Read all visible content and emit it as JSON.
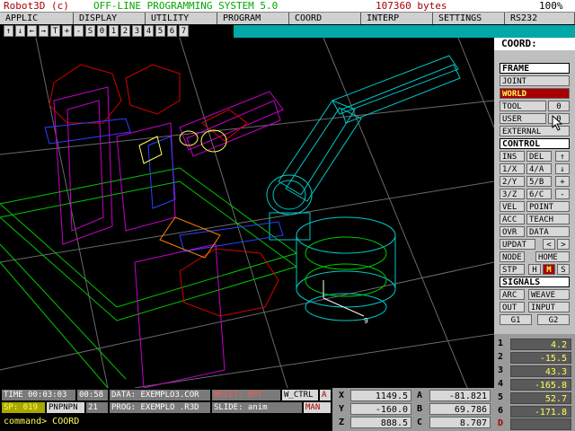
{
  "titlebar": {
    "app": "Robot3D (c)",
    "title": "OFF-LINE PROGRAMMING SYSTEM 5.0",
    "memory": "107360 bytes",
    "zoom": "100%"
  },
  "menu": [
    "APPLIC",
    "DISPLAY",
    "UTILITY",
    "PROGRAM",
    "COORD",
    "",
    "INTERP",
    "SETTINGS",
    "RS232"
  ],
  "toolbar": [
    "↑",
    "↓",
    "←",
    "→",
    "T",
    "+",
    "-",
    "S",
    "0",
    "1",
    "2",
    "3",
    "4",
    "5",
    "6",
    "7"
  ],
  "panel": {
    "coord_header": "COORD:",
    "frame_title": "FRAME",
    "joint": "JOINT",
    "world": "WORLD",
    "tool": "TOOL",
    "tool_val": "0",
    "user": "USER",
    "user_val": "0",
    "external": "EXTERNAL",
    "control_title": "CONTROL",
    "ins": "INS",
    "del": "DEL",
    "up": "↑",
    "k1x": "1/X",
    "k4a": "4/A",
    "down": "↓",
    "k2y": "2/Y",
    "k5b": "5/B",
    "plus": "+",
    "k3z": "3/Z",
    "k6c": "6/C",
    "minus": "-",
    "vel": "VEL",
    "point": "POINT",
    "acc": "ACC",
    "teach": "TEACH",
    "ovr": "OVR",
    "data": "DATA",
    "updat": "UPDAT",
    "lt": "<",
    "gt": ">",
    "node": "NODE",
    "home": "HOME",
    "stp": "STP",
    "h": "H",
    "m": "M",
    "s": "S",
    "signals_title": "SIGNALS",
    "arc": "ARC",
    "weave": "WEAVE",
    "out": "OUT",
    "input": "INPUT",
    "g1": "G1",
    "g2": "G2"
  },
  "status": {
    "time": "TIME 00:03:03",
    "elapsed": "00:58",
    "data_file": "DATA: EXEMPLO3.COR",
    "wrist": "WRIST: RPY",
    "wctrl": "W_CTRL",
    "a_flag": "A",
    "sp": "SP: 019",
    "pnpnpn": "PNPNPN",
    "n21": "21",
    "prog_file": "PROG: EXEMPLO .R3D",
    "slide": "SLIDE: anim",
    "man": "MAN",
    "command": "command> COORD"
  },
  "pose": {
    "x_label": "X",
    "x": "1149.5",
    "y_label": "Y",
    "y": "-160.0",
    "z_label": "Z",
    "z": "888.5",
    "a_label": "A",
    "a": "-81.821",
    "b_label": "B",
    "b": "69.786",
    "c_label": "C",
    "c": "8.707"
  },
  "joints": [
    {
      "n": "1",
      "v": "4.2"
    },
    {
      "n": "2",
      "v": "-15.5"
    },
    {
      "n": "3",
      "v": "43.3"
    },
    {
      "n": "4",
      "v": "-165.8"
    },
    {
      "n": "5",
      "v": "52.7"
    },
    {
      "n": "6",
      "v": "-171.8"
    },
    {
      "n": "D",
      "v": ""
    }
  ],
  "colors": {
    "cyan": "#00a8a8",
    "world_active": "#a80000",
    "title_red": "#a80000",
    "title_green": "#00a800",
    "joint_value": "#ffff55"
  }
}
